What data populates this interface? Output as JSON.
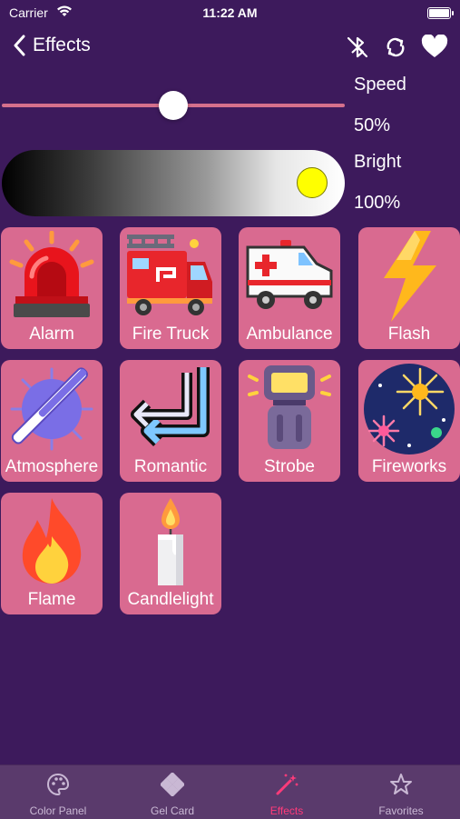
{
  "status_bar": {
    "carrier": "Carrier",
    "time": "11:22 AM"
  },
  "nav": {
    "back_label": "Effects"
  },
  "speed": {
    "label": "Speed",
    "value": "50%",
    "level": 0.5
  },
  "bright": {
    "label": "Bright",
    "value": "100%",
    "level": 1.0
  },
  "effects": [
    {
      "label": "Alarm",
      "icon": "siren-icon"
    },
    {
      "label": "Fire Truck",
      "icon": "fire-truck-icon"
    },
    {
      "label": "Ambulance",
      "icon": "ambulance-icon"
    },
    {
      "label": "Flash",
      "icon": "lightning-icon"
    },
    {
      "label": "Atmosphere",
      "icon": "atmosphere-icon"
    },
    {
      "label": "Romantic",
      "icon": "neon-arrow-icon"
    },
    {
      "label": "Strobe",
      "icon": "strobe-light-icon"
    },
    {
      "label": "Fireworks",
      "icon": "fireworks-icon"
    },
    {
      "label": "Flame",
      "icon": "flame-icon"
    },
    {
      "label": "Candlelight",
      "icon": "candle-icon"
    }
  ],
  "tabs": [
    {
      "label": "Color Panel",
      "icon": "palette-icon"
    },
    {
      "label": "Gel Card",
      "icon": "gel-card-icon"
    },
    {
      "label": "Effects",
      "icon": "magic-wand-icon",
      "active": true
    },
    {
      "label": "Favorites",
      "icon": "star-icon"
    }
  ],
  "colors": {
    "background": "#3d1a5c",
    "tile": "#d96a90",
    "accent": "#ff3b7a",
    "brightness_thumb": "#ffff00"
  }
}
